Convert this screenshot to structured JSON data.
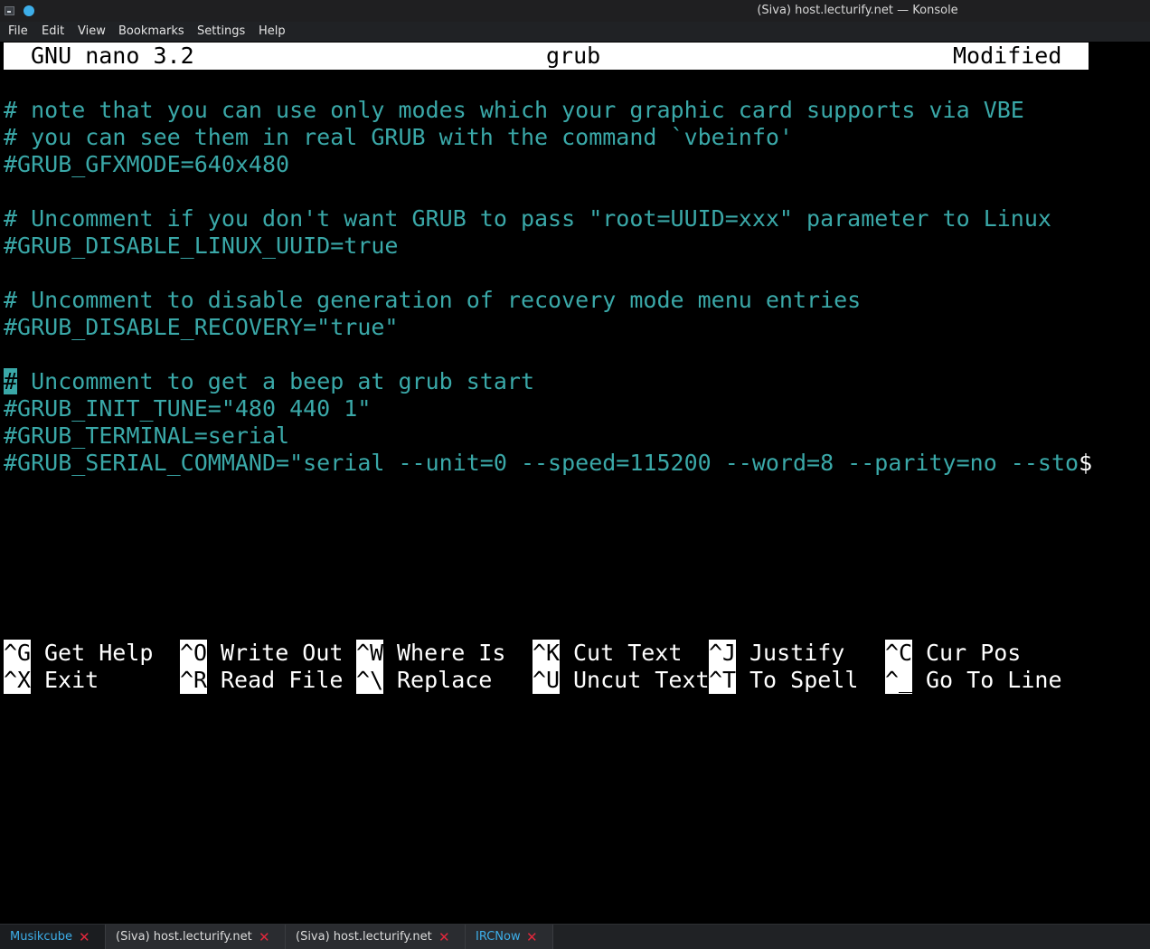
{
  "titlebar": {
    "title": "(Siva) host.lecturify.net — Konsole"
  },
  "menubar": {
    "items": [
      "File",
      "Edit",
      "View",
      "Bookmarks",
      "Settings",
      "Help"
    ]
  },
  "nano": {
    "header": {
      "app": "GNU nano 3.2",
      "filename": "grub",
      "status": "Modified"
    },
    "lines": [
      "# note that you can use only modes which your graphic card supports via VBE",
      "# you can see them in real GRUB with the command `vbeinfo'",
      "#GRUB_GFXMODE=640x480",
      "",
      "# Uncomment if you don't want GRUB to pass \"root=UUID=xxx\" parameter to Linux",
      "#GRUB_DISABLE_LINUX_UUID=true",
      "",
      "# Uncomment to disable generation of recovery mode menu entries",
      "#GRUB_DISABLE_RECOVERY=\"true\"",
      "",
      " Uncomment to get a beep at grub start",
      "#GRUB_INIT_TUNE=\"480 440 1\"",
      "#GRUB_TERMINAL=serial",
      "#GRUB_SERIAL_COMMAND=\"serial --unit=0 --speed=115200 --word=8 --parity=no --sto"
    ],
    "cursor_char": "#",
    "truncation_marker": "$",
    "shortcuts_row1": [
      {
        "key": "^G",
        "label": "Get Help"
      },
      {
        "key": "^O",
        "label": "Write Out"
      },
      {
        "key": "^W",
        "label": "Where Is"
      },
      {
        "key": "^K",
        "label": "Cut Text"
      },
      {
        "key": "^J",
        "label": "Justify"
      },
      {
        "key": "^C",
        "label": "Cur Pos"
      }
    ],
    "shortcuts_row2": [
      {
        "key": "^X",
        "label": "Exit"
      },
      {
        "key": "^R",
        "label": "Read File"
      },
      {
        "key": "^\\",
        "label": "Replace"
      },
      {
        "key": "^U",
        "label": "Uncut Text"
      },
      {
        "key": "^T",
        "label": "To Spell"
      },
      {
        "key": "^_",
        "label": "Go To Line"
      }
    ]
  },
  "tabs": [
    {
      "label": "Musikcube"
    },
    {
      "label": "(Siva) host.lecturify.net"
    },
    {
      "label": "(Siva) host.lecturify.net"
    },
    {
      "label": "IRCNow"
    }
  ],
  "colors": {
    "terminal_text": "#3aa8a8",
    "accent": "#3daee9",
    "close": "#e0283c"
  }
}
